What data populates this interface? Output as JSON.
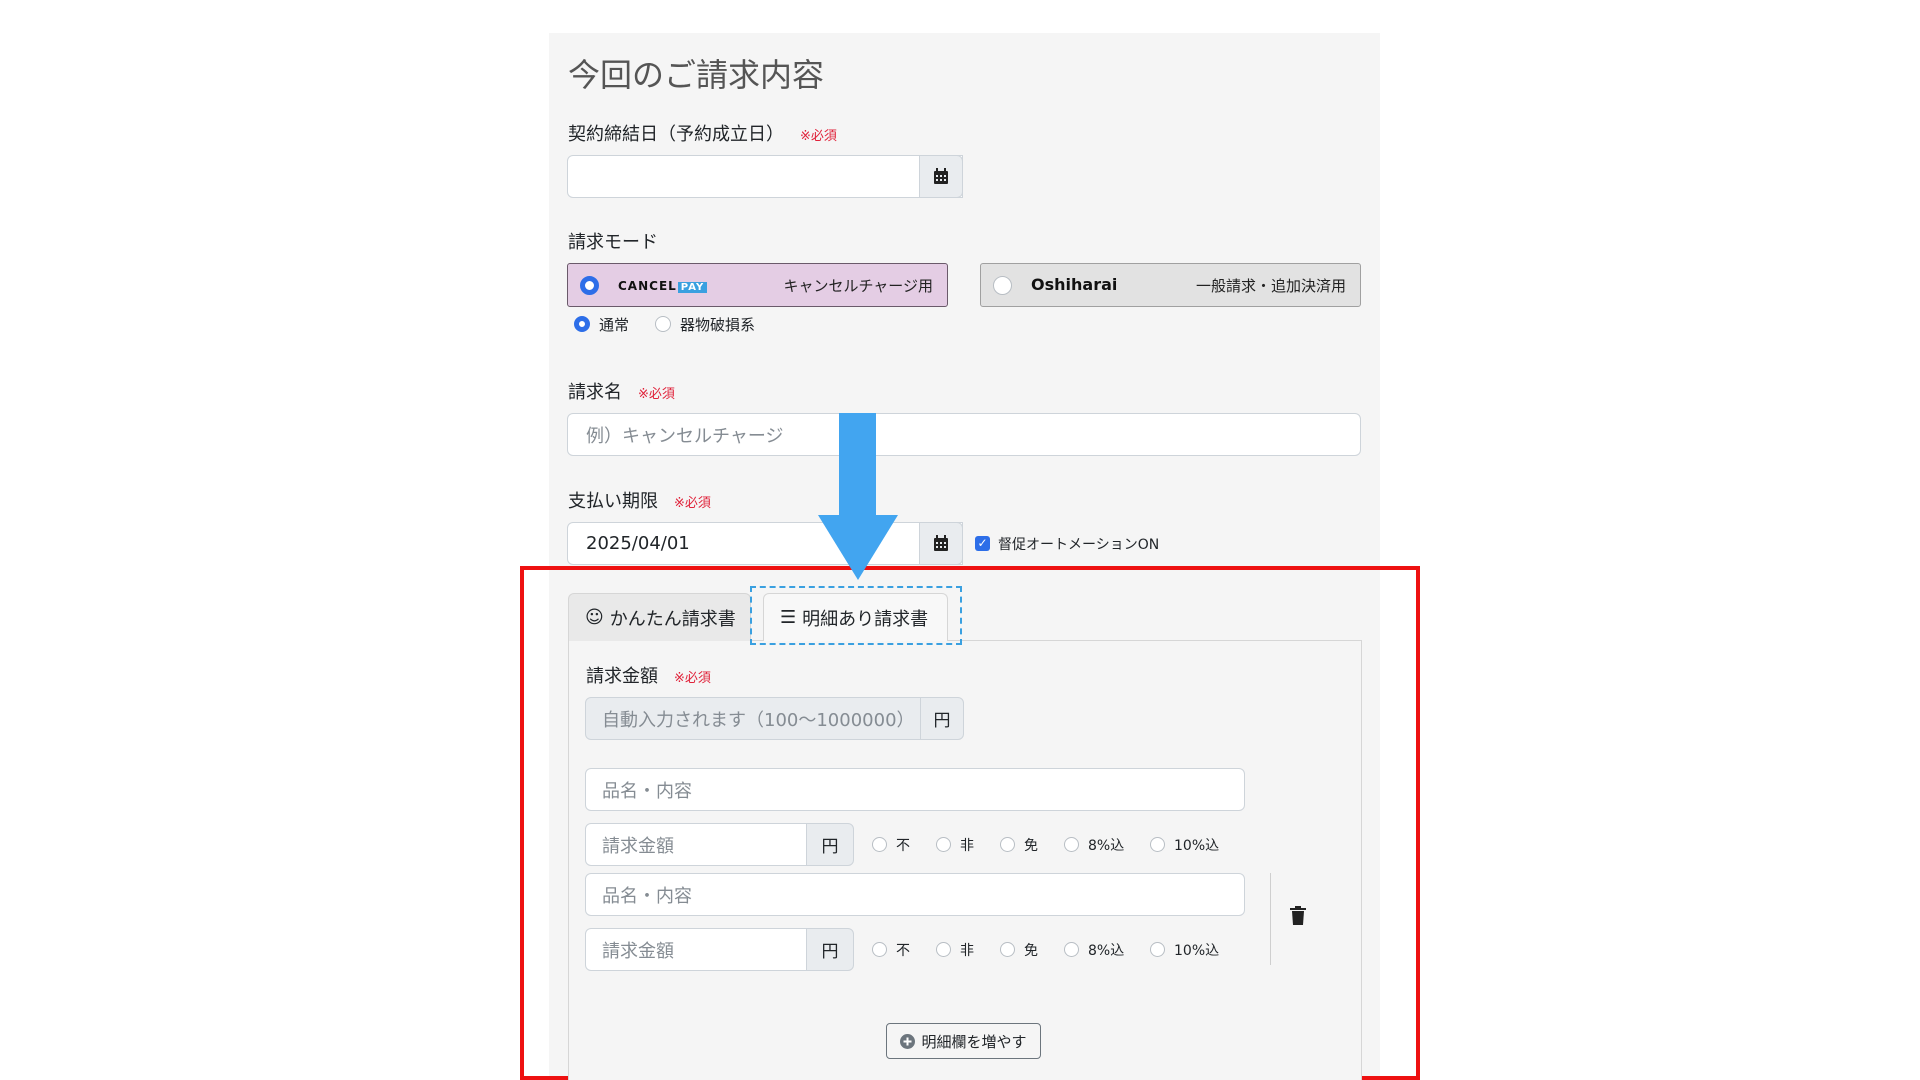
{
  "section_title": "今回のご請求内容",
  "required_mark": "※必須",
  "contract_date": {
    "label": "契約締結日（予約成立日）",
    "value": ""
  },
  "billing_mode": {
    "label": "請求モード",
    "option1": {
      "brand": "CANCEL",
      "brand_badge": "PAY",
      "desc": "キャンセルチャージ用",
      "selected": true
    },
    "option2": {
      "brand": "Oshiharai",
      "desc": "一般請求・追加決済用",
      "selected": false
    },
    "sub_options": [
      {
        "label": "通常",
        "selected": true
      },
      {
        "label": "器物破損系",
        "selected": false
      }
    ]
  },
  "invoice_name": {
    "label": "請求名",
    "placeholder": "例）キャンセルチャージ"
  },
  "due_date": {
    "label": "支払い期限",
    "value": "2025/04/01",
    "automation_label": "督促オートメーションON",
    "automation_checked": true
  },
  "tabs": [
    {
      "label": "かんたん請求書",
      "icon": "smile-icon"
    },
    {
      "label": "明細あり請求書",
      "icon": "list-icon"
    }
  ],
  "amount": {
    "label": "請求金額",
    "placeholder": "自動入力されます（100〜1000000）",
    "unit": "円"
  },
  "line_items": [
    {
      "item_placeholder": "品名・内容",
      "amount_placeholder": "請求金額",
      "unit": "円",
      "tax_options": [
        "不",
        "非",
        "免",
        "8%込",
        "10%込"
      ]
    },
    {
      "item_placeholder": "品名・内容",
      "amount_placeholder": "請求金額",
      "unit": "円",
      "tax_options": [
        "不",
        "非",
        "免",
        "8%込",
        "10%込"
      ]
    }
  ],
  "add_row_button": "明細欄を増やす",
  "colors": {
    "accent_blue": "#2d6ee8",
    "highlight_red": "#ee1111",
    "arrow_blue": "#42a5f0",
    "cancelpay_bg": "#e4cde4"
  }
}
